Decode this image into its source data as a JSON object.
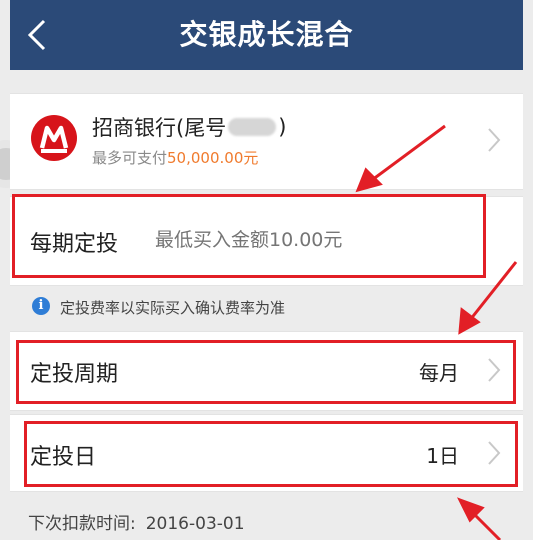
{
  "header": {
    "title": "交银成长混合",
    "back_icon": "chevron-left-icon"
  },
  "payment_card": {
    "bank_name_prefix": "招商银行(尾号",
    "bank_name_suffix": ")",
    "limit_prefix": "最多可支付",
    "limit_amount": "50,000.00元",
    "logo_icon": "cmb-bank-logo",
    "chevron_icon": "chevron-right-icon"
  },
  "amount_row": {
    "label": "每期定投",
    "placeholder": "最低买入金额10.00元"
  },
  "notice": {
    "icon": "info-icon",
    "icon_glyph": "i",
    "text": "定投费率以实际买入确认费率为准"
  },
  "period_row": {
    "label": "定投周期",
    "value": "每月"
  },
  "day_row": {
    "label": "定投日",
    "value": "1日"
  },
  "next_deduct": {
    "label": "下次扣款时间:",
    "date": "2016-03-01"
  },
  "colors": {
    "header_bg": "#2b4a78",
    "accent_orange": "#f07b2e",
    "highlight_red": "#e21f26",
    "info_blue": "#2f7dd6",
    "page_bg": "#ececec"
  }
}
